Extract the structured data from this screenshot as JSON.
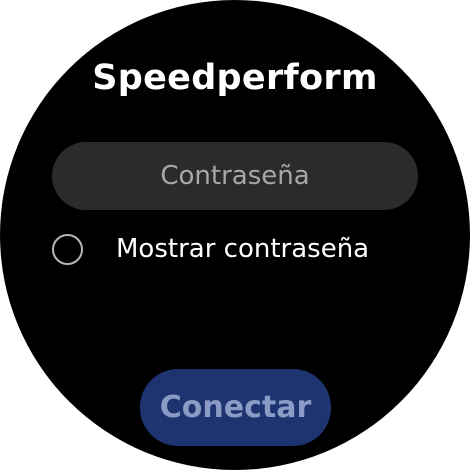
{
  "app": {
    "title": "Speedperform"
  },
  "password": {
    "placeholder": "Contraseña",
    "value": ""
  },
  "show_password": {
    "label": "Mostrar contraseña",
    "checked": false
  },
  "actions": {
    "connect_label": "Conectar"
  },
  "colors": {
    "background": "#000000",
    "field_background": "#2b2b2b",
    "button_background": "#1e3470",
    "button_text": "#8a9bc6"
  }
}
